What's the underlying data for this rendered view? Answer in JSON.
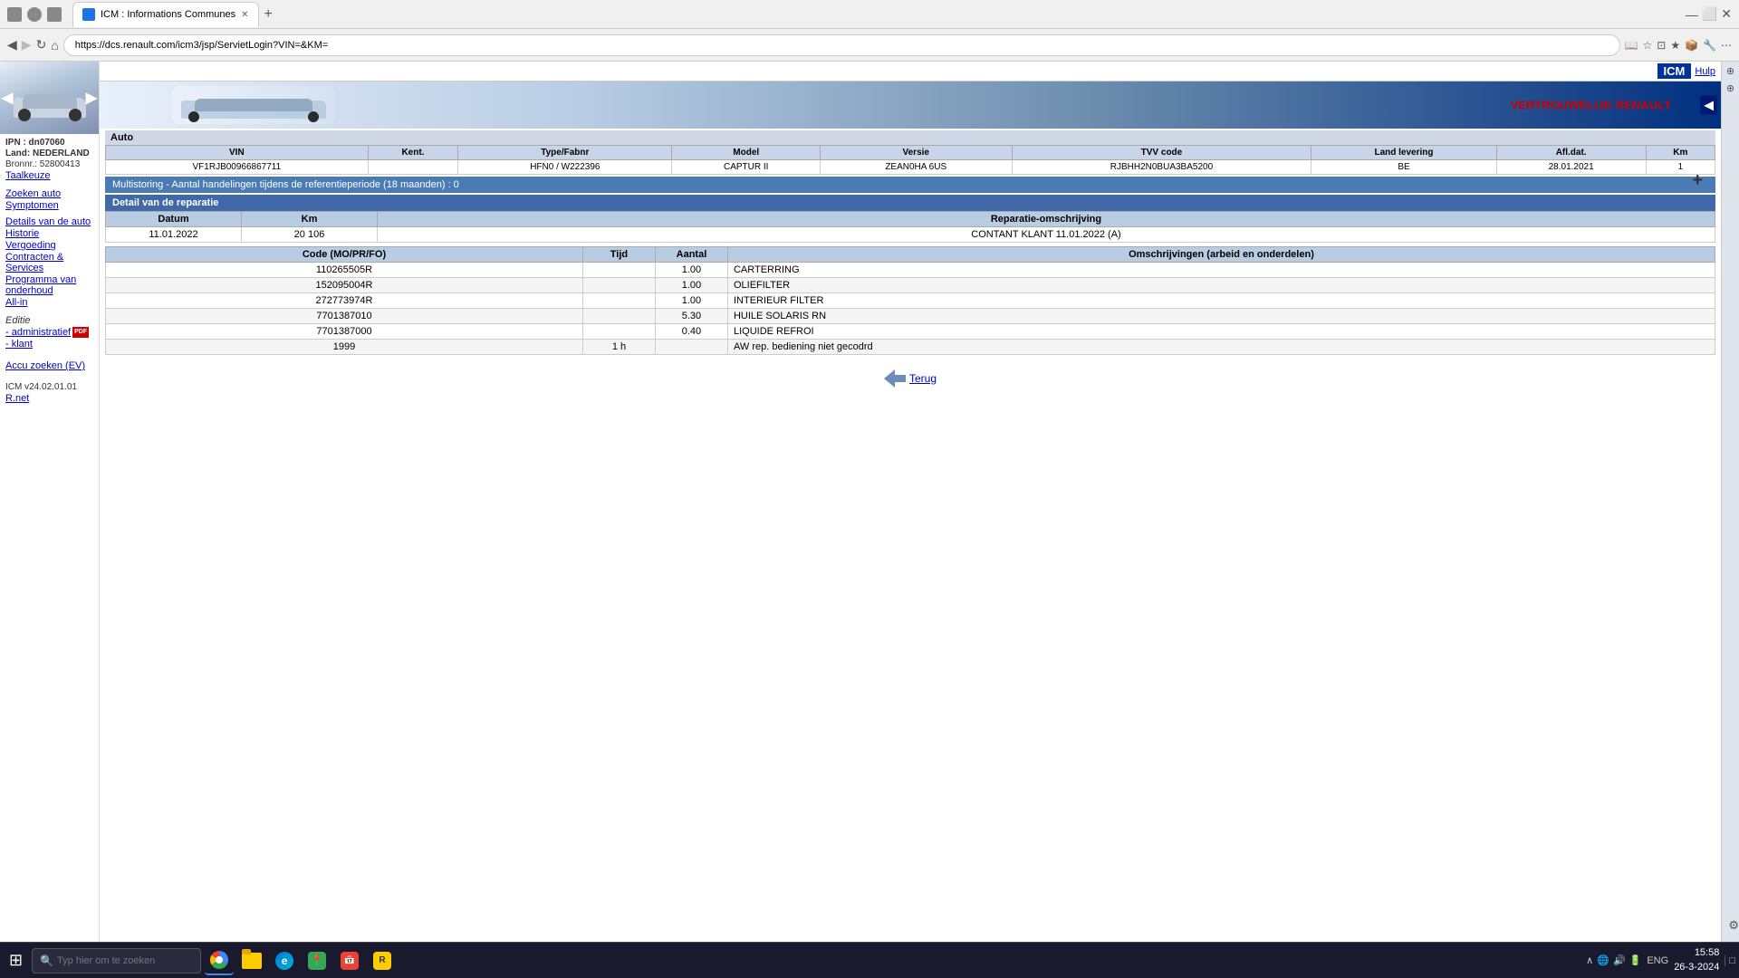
{
  "browser": {
    "tab_title": "ICM : Informations Communes",
    "url": "https://dcs.renault.com/icm3/jsp/ServietLogin?VIN=&KM=",
    "new_tab_label": "+"
  },
  "icm": {
    "logo": "ICM",
    "help_label": "Hulp"
  },
  "sidebar": {
    "ipn_label": "IPN : dn07060",
    "land_label": "Land: NEDERLAND",
    "bronnr_label": "Bronnr.: 52800413",
    "taal_label": "Taalkeuze",
    "zoeken_auto": "Zoeken auto",
    "symptomen": "Symptomen",
    "details_van_auto": "Details van de auto",
    "historie": "Historie",
    "vergoeding": "Vergoeding",
    "contracten_services": "Contracten & Services",
    "programma_van_onderhoud": "Programma van onderhoud",
    "all_in": "All-in",
    "editie_label": "Editie",
    "administratief": "- administratief",
    "klant": "- klant",
    "accu_zoeken": "Accu zoeken (EV)",
    "version_label": "ICM v24.02.01.01",
    "rnet_label": "R.net"
  },
  "confidential": "VERTROUWELIJK RENAULT",
  "auto_section": {
    "header": "Auto",
    "vin_col": "VIN",
    "kent_col": "Kent.",
    "type_fabnr_col": "Type/Fabnr",
    "model_col": "Model",
    "versie_col": "Versie",
    "tvv_code_col": "TVV code",
    "land_levering_col": "Land levering",
    "afl_dat_col": "Afl.dat.",
    "km_col": "Km",
    "vin_val": "VF1RJB00966867711",
    "kent_val": "",
    "type_fabnr_val": "HFN0 / W222396",
    "model_val": "CAPTUR II",
    "versie_val": "ZEAN0HA 6US",
    "tvv_code_val": "RJBHH2N0BUA3BA5200",
    "land_levering_val": "BE",
    "afl_dat_val": "28.01.2021",
    "km_val": "1"
  },
  "multistoring": {
    "text": "Multistoring - Aantal handelingen tijdens de referentieperiode (18 maanden) : 0"
  },
  "detail_reparatie": {
    "header": "Detail van de reparatie",
    "datum_col": "Datum",
    "km_col": "Km",
    "reparatie_omschr_col": "Reparatie-omschrijving",
    "datum_val": "11.01.2022",
    "km_val": "20 106",
    "reparatie_omschr_val": "CONTANT KLANT 11.01.2022 (A)",
    "code_col": "Code (MO/PR/FO)",
    "tijd_col": "Tijd",
    "aantal_col": "Aantal",
    "omschr_col": "Omschrijvingen (arbeid en onderdelen)",
    "rows": [
      {
        "code": "110265505R",
        "tijd": "",
        "aantal": "1.00",
        "omschr": "CARTERRING"
      },
      {
        "code": "152095004R",
        "tijd": "",
        "aantal": "1.00",
        "omschr": "OLIEFILTER"
      },
      {
        "code": "272773974R",
        "tijd": "",
        "aantal": "1.00",
        "omschr": "INTERIEUR FILTER"
      },
      {
        "code": "7701387010",
        "tijd": "",
        "aantal": "5.30",
        "omschr": "HUILE SOLARIS RN"
      },
      {
        "code": "7701387000",
        "tijd": "",
        "aantal": "0.40",
        "omschr": "LIQUIDE REFROI"
      },
      {
        "code": "1999",
        "tijd": "1 h",
        "aantal": "",
        "omschr": "AW rep. bediening niet gecodrd"
      }
    ]
  },
  "terug": {
    "label": "Terug"
  },
  "taskbar": {
    "search_placeholder": "Typ hier om te zoeken",
    "time": "15:58",
    "date": "26-3-2024",
    "lang": "ENG"
  }
}
